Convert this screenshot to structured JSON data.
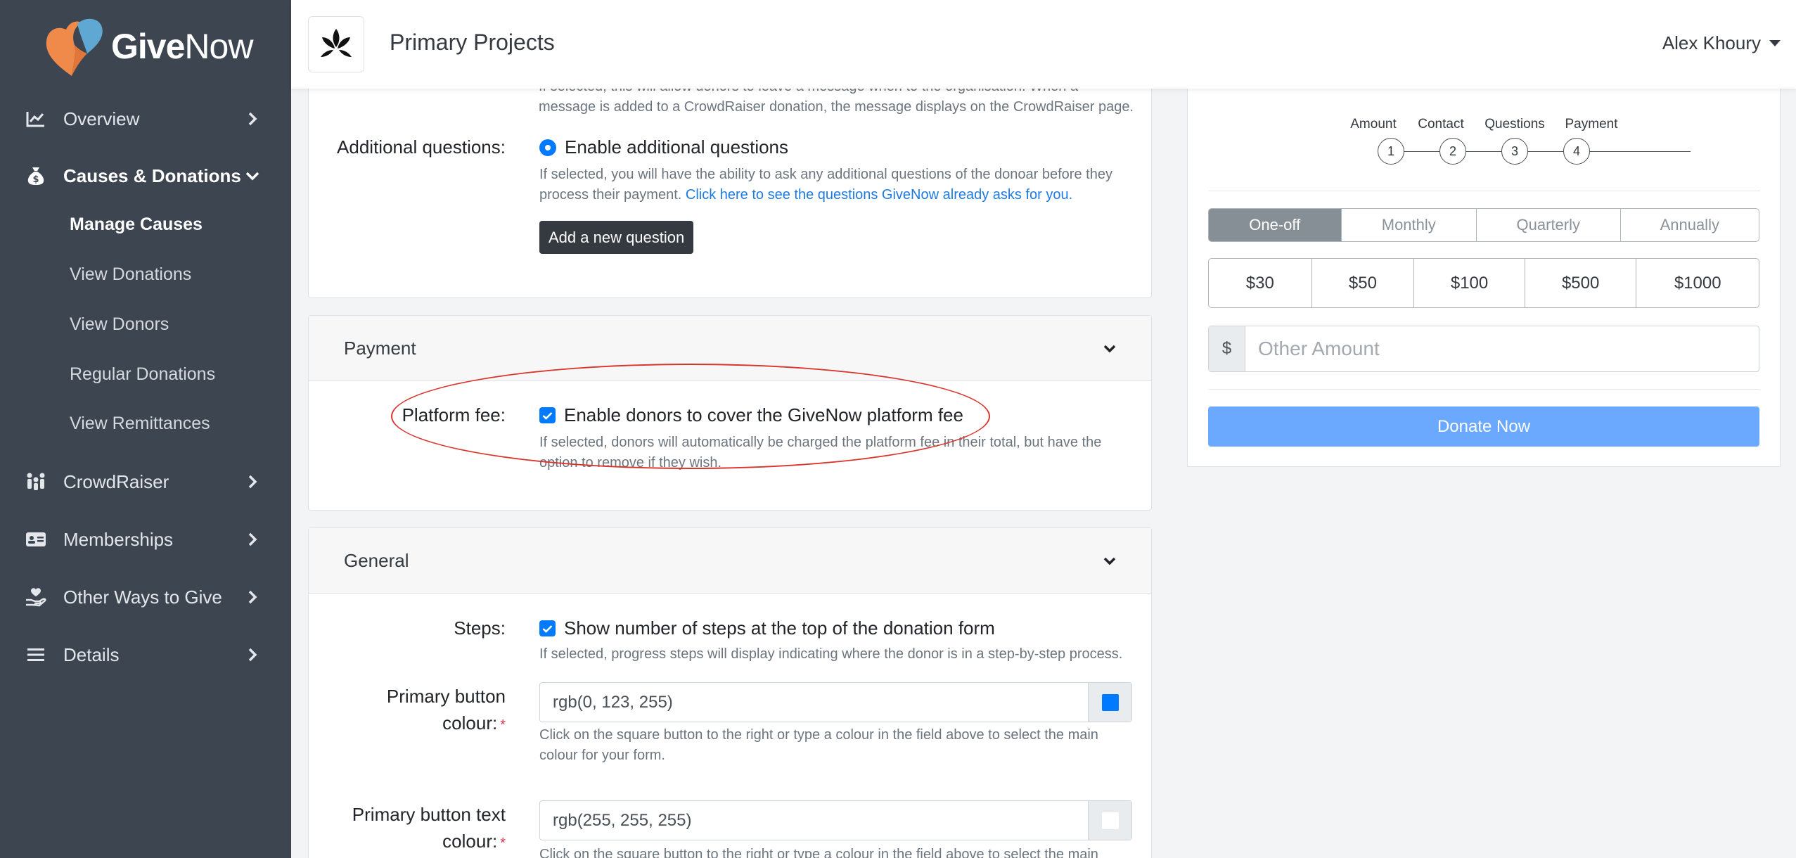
{
  "app": {
    "brand": {
      "give": "Give",
      "now": "Now"
    }
  },
  "sidebar": {
    "items": [
      {
        "label": "Overview",
        "icon": "chart-line-icon"
      },
      {
        "label": "Causes & Donations",
        "icon": "money-bag-icon",
        "expanded": true
      },
      {
        "label": "CrowdRaiser",
        "icon": "people-group-icon"
      },
      {
        "label": "Memberships",
        "icon": "id-card-icon"
      },
      {
        "label": "Other Ways to Give",
        "icon": "hand-holding-heart-icon"
      },
      {
        "label": "Details",
        "icon": "list-icon"
      }
    ],
    "subitems": [
      {
        "label": "Manage Causes",
        "active": true
      },
      {
        "label": "View Donations"
      },
      {
        "label": "View Donors"
      },
      {
        "label": "Regular Donations"
      },
      {
        "label": "View Remittances"
      }
    ]
  },
  "header": {
    "org_name": "Primary Projects",
    "user_name": "Alex Khoury"
  },
  "form": {
    "message_help": "If selected, this will allow donors to leave a message when to the organisation. When a message is added to a CrowdRaiser donation, the message displays on the CrowdRaiser page.",
    "additional_questions": {
      "label": "Additional questions:",
      "option": "Enable additional questions",
      "help": "If selected, you will have the ability to ask any additional questions of the donoar before they process their payment.",
      "help_link": "Click here to see the questions GiveNow already asks for you.",
      "button": "Add a new question"
    },
    "payment": {
      "title": "Payment",
      "platform_fee_label": "Platform fee:",
      "platform_fee_option": "Enable donors to cover the GiveNow platform fee",
      "platform_fee_help": "If selected, donors will automatically be charged the platform fee in their total, but have the option to remove if they wish."
    },
    "general": {
      "title": "General",
      "steps_label": "Steps:",
      "steps_option": "Show number of steps at the top of the donation form",
      "steps_help": "If selected, progress steps will display indicating where the donor is in a step-by-step process.",
      "primary_colour_label_1": "Primary button",
      "primary_colour_label_2": "colour:",
      "primary_colour_value": "rgb(0, 123, 255)",
      "primary_colour_swatch": "#007bff",
      "primary_colour_help": "Click on the square button to the right or type a colour in the field above to select the main colour for your form.",
      "text_colour_label_1": "Primary button text",
      "text_colour_label_2": "colour:",
      "text_colour_value": "rgb(255, 255, 255)",
      "text_colour_swatch": "#ffffff",
      "text_colour_help": "Click on the square button to the right or type a colour in the field above to select the main",
      "required_mark": "*"
    }
  },
  "preview": {
    "steps": [
      {
        "label": "Amount",
        "num": "1"
      },
      {
        "label": "Contact",
        "num": "2"
      },
      {
        "label": "Questions",
        "num": "3"
      },
      {
        "label": "Payment",
        "num": "4"
      }
    ],
    "frequencies": [
      "One-off",
      "Monthly",
      "Quarterly",
      "Annually"
    ],
    "selected_frequency": "One-off",
    "amounts": [
      "$30",
      "$50",
      "$100",
      "$500",
      "$1000"
    ],
    "currency_symbol": "$",
    "other_amount_placeholder": "Other Amount",
    "donate_button": "Donate Now"
  },
  "colors": {
    "sidebar_bg": "#3d4550",
    "accent": "#007bff",
    "donate_button": "#6aa9ff",
    "annotation": "#d9352c"
  }
}
